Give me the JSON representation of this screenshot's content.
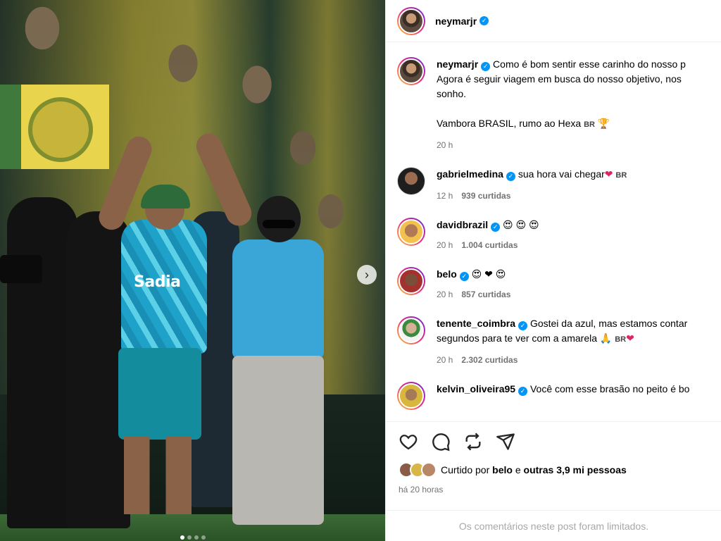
{
  "post": {
    "image": {
      "next_label": "›",
      "slide_count": 4,
      "active_slide": 0,
      "shirt_logo": "Sadia"
    },
    "author": "neymarjr",
    "caption": {
      "line1": "Como é bom sentir esse carinho do nosso p",
      "line2": "Agora é seguir viagem em busca do nosso objetivo, nos",
      "line3": "sonho.",
      "line4": "Vambora BRASIL, rumo ao Hexa",
      "flag": "BR",
      "trophy": "🏆",
      "time": "20 h"
    },
    "comments": [
      {
        "user": "gabrielmedina",
        "text": "sua hora vai chegar",
        "emoji": "❤",
        "flag": "BR",
        "time": "12 h",
        "likes": "939 curtidas"
      },
      {
        "user": "davidbrazil",
        "text": "",
        "emoji": "😍 😍 😍",
        "flag": "",
        "time": "20 h",
        "likes": "1.004 curtidas"
      },
      {
        "user": "belo",
        "text": "",
        "emoji": "😍 ❤ 😍",
        "flag": "",
        "time": "20 h",
        "likes": "857 curtidas"
      },
      {
        "user": "tenente_coimbra",
        "line1": "Gostei da azul, mas estamos contar",
        "line2": "segundos para te ver com a amarela",
        "emoji": "🙏",
        "flag": "BR",
        "heart": "❤",
        "time": "20 h",
        "likes": "2.302 curtidas"
      },
      {
        "user": "kelvin_oliveira95",
        "text": "Você com esse brasão no peito é bo"
      }
    ],
    "liked_by": {
      "prefix": "Curtido por",
      "user": "belo",
      "joiner": "e",
      "others": "outras 3,9 mi pessoas"
    },
    "posted": "há 20 horas",
    "comments_limited": "Os comentários neste post foram limitados."
  },
  "colors": {
    "verified": "#0095f6",
    "meta": "#737373",
    "heart": "#e0245e"
  }
}
